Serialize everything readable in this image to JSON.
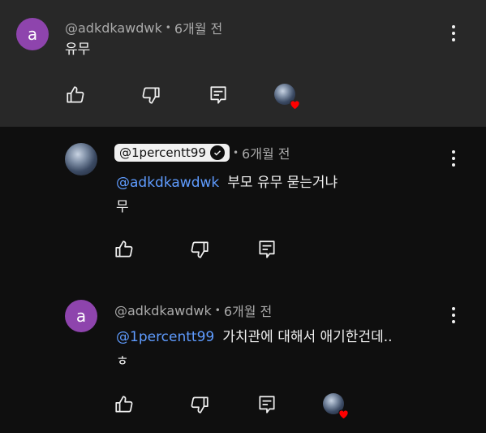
{
  "comments": [
    {
      "avatar_letter": "a",
      "author": "@adkdkawdwk",
      "time": "6개월 전",
      "text": "유무"
    },
    {
      "author": "@1percentt99",
      "time": "6개월 전",
      "mention": "@adkdkawdwk",
      "line1": "부모 유무 묻는거냐",
      "line2": "무"
    },
    {
      "avatar_letter": "a",
      "author": "@adkdkawdwk",
      "time": "6개월 전",
      "mention": "@1percentt99",
      "line1": "가치관에 대해서 애기한건데..",
      "line2": "ㅎ"
    }
  ],
  "icons": {
    "like": "thumbs-up-icon",
    "dislike": "thumbs-down-icon",
    "reply": "reply-icon",
    "more": "more-vert-icon",
    "creator_heart": "creator-heart-icon",
    "verified": "verified-check-icon"
  },
  "colors": {
    "mention": "#5f9cff",
    "heart": "#ff0000",
    "avatar_letter_bg": "#8e44ad"
  }
}
